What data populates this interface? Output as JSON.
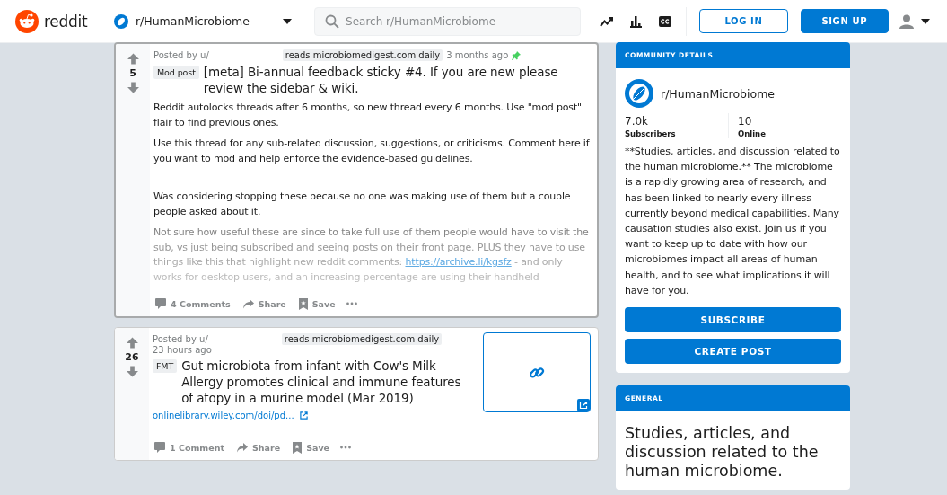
{
  "header": {
    "logo_text": "reddit",
    "community": "r/HumanMicrobiome",
    "search_placeholder": "Search r/HumanMicrobiome",
    "login": "LOG IN",
    "signup": "SIGN UP"
  },
  "posts": [
    {
      "highlighted": true,
      "votes": "5",
      "posted_by": "Posted by u/",
      "user_flair": "reads microbiomedigest.com daily",
      "time": "3 months ago",
      "pinned": true,
      "flair": "Mod post",
      "title": "[meta] Bi-annual feedback sticky #4. If you are new please review the sidebar & wiki.",
      "paragraphs": [
        {
          "faded": false,
          "parts": [
            {
              "text": "Reddit autolocks threads after 6 months, so new thread every 6 months. Use \"mod post\" flair to find previous ones."
            }
          ]
        },
        {
          "faded": false,
          "parts": [
            {
              "text": "Use this thread for any sub-related discussion, suggestions, or criticisms. Comment here if you want to mod and help enforce the evidence-based guidelines."
            }
          ]
        },
        {
          "faded": false,
          "parts": [
            {
              "text": "Was considering stopping these because no one was making use of them but a couple people asked about it."
            }
          ]
        },
        {
          "faded": true,
          "parts": [
            {
              "text": "Not sure how useful these are since to take full use of them people would have to visit the sub, vs just being subscribed and seeing posts on their front page. PLUS they have to use things like this that highlight new reddit comments: "
            },
            {
              "link": "https://archive.li/kgsfz"
            },
            {
              "text": " - and only works for desktop users, and an increasing percentage are using their handheld"
            }
          ]
        }
      ],
      "comments": "4 Comments",
      "share": "Share",
      "save": "Save"
    },
    {
      "highlighted": false,
      "votes": "26",
      "posted_by": "Posted by u/",
      "user_flair": "reads microbiomedigest.com daily",
      "time": "23 hours ago",
      "pinned": false,
      "flair": "FMT",
      "title": "Gut microbiota from infant with Cow's Milk Allergy promotes clinical and immune features of atopy in a murine model (Mar 2019)",
      "domain": "onlinelibrary.wiley.com/doi/pd...",
      "thumbnail": {
        "kind": "link"
      },
      "comments": "1 Comment",
      "share": "Share",
      "save": "Save"
    }
  ],
  "sidebar": {
    "details": {
      "heading": "COMMUNITY DETAILS",
      "name": "r/HumanMicrobiome",
      "subscribers": "7.0k",
      "subscribers_label": "Subscribers",
      "online": "10",
      "online_label": "Online",
      "description": "**Studies, articles, and discussion related to the human microbiome.** The microbiome is a rapidly growing area of research, and has been linked to nearly every illness currently beyond medical capabilities. Many causation studies also exist. Join us if you want to keep up to date with how our microbiomes impact all areas of human health, and to see what implications it will have for you.",
      "buttons": [
        "SUBSCRIBE",
        "CREATE POST"
      ]
    },
    "general": {
      "heading": "GENERAL",
      "text": "Studies, articles, and discussion related to the human microbiome."
    }
  }
}
